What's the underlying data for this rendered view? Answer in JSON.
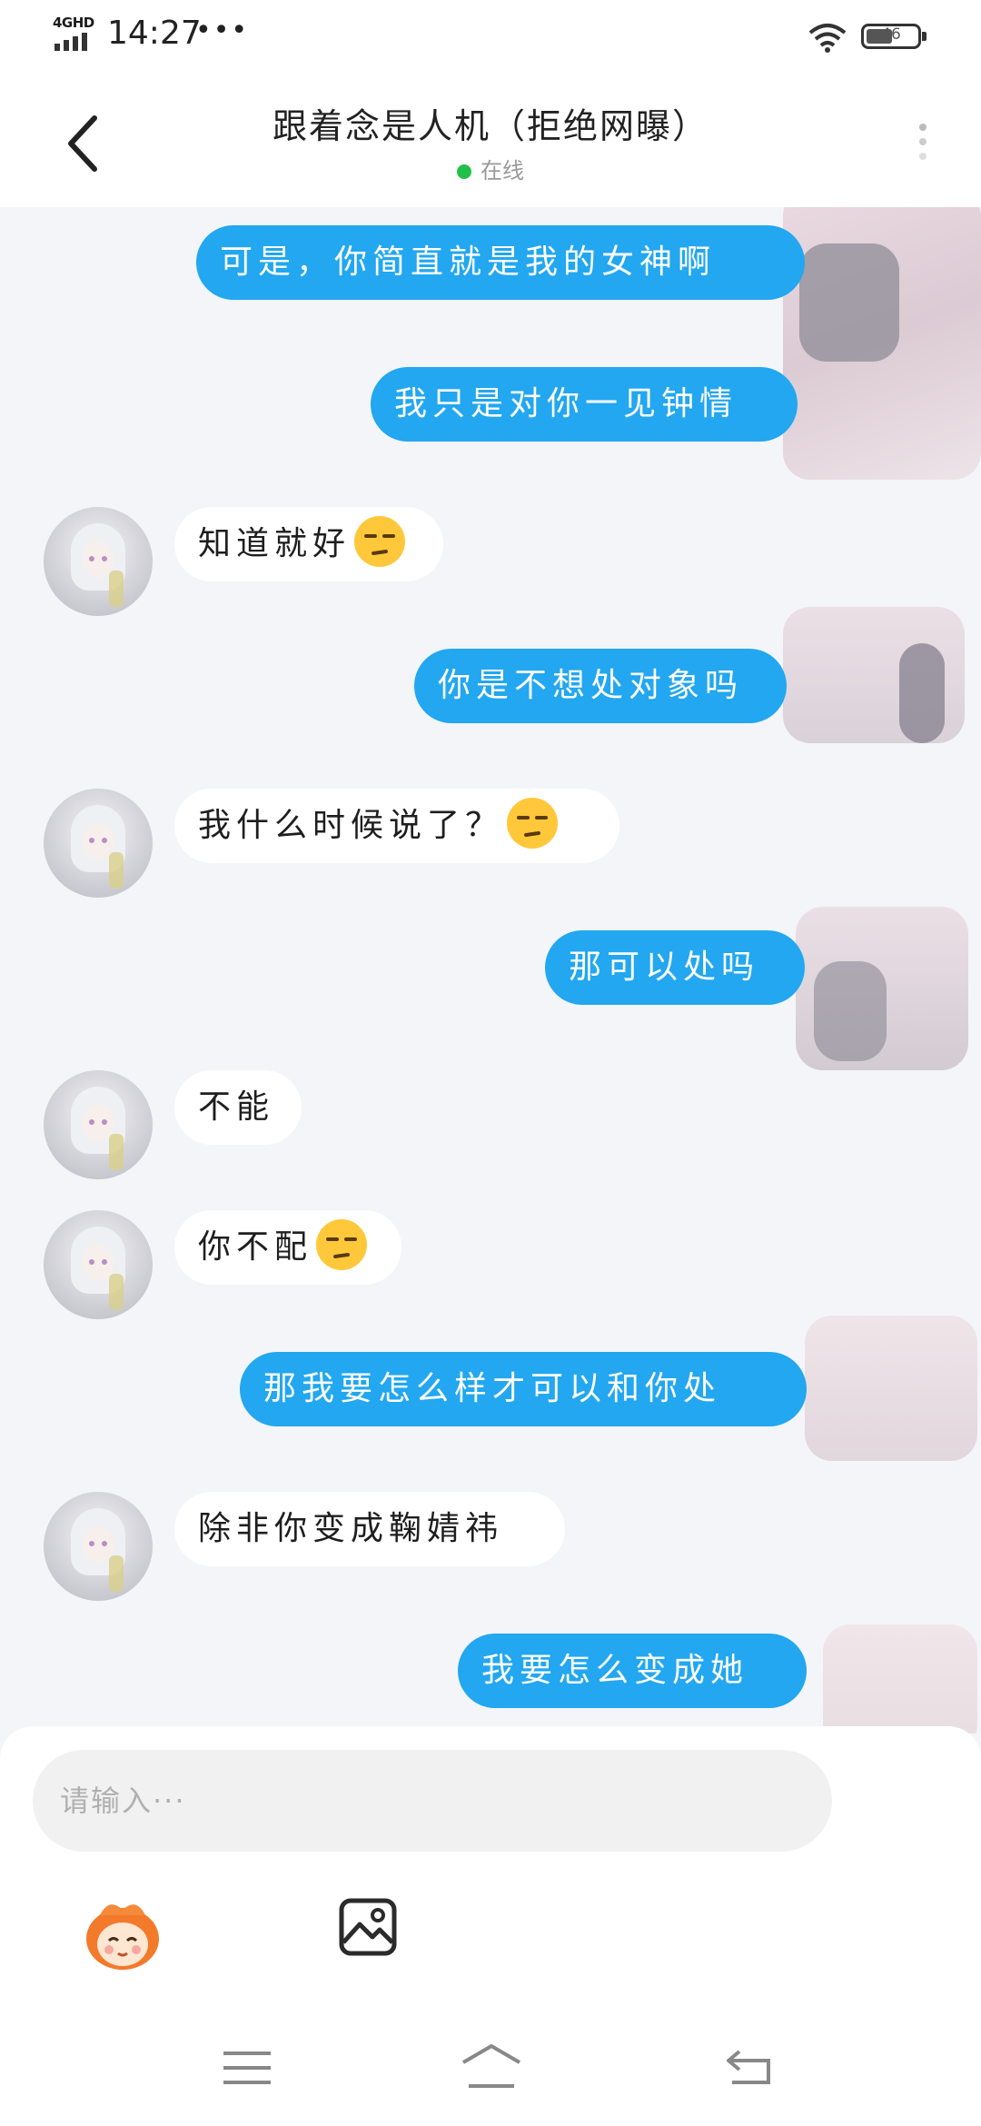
{
  "status_bar": {
    "network": "4GHD",
    "time": "14:27",
    "dots": "•••",
    "battery": "46",
    "icons": [
      "signal-icon",
      "wifi-icon",
      "battery-icon"
    ]
  },
  "header": {
    "title": "跟着念是人机（拒绝网曝）",
    "status": "在线",
    "back_icon": "chevron-left-icon",
    "more_icon": "more-vertical-icon"
  },
  "messages": [
    {
      "side": "out",
      "text": "可是，你简直就是我的女神啊"
    },
    {
      "side": "out",
      "text": "我只是对你一见钟情"
    },
    {
      "side": "in",
      "text": "知道就好",
      "emoji": "unamused-face-icon"
    },
    {
      "side": "out",
      "text": "你是不想处对象吗"
    },
    {
      "side": "in",
      "text": "我什么时候说了？",
      "emoji": "unamused-face-icon"
    },
    {
      "side": "out",
      "text": "那可以处吗"
    },
    {
      "side": "in",
      "text": "不能"
    },
    {
      "side": "in",
      "text": "你不配",
      "emoji": "unamused-face-icon"
    },
    {
      "side": "out",
      "text": "那我要怎么样才可以和你处"
    },
    {
      "side": "in",
      "text": "除非你变成鞠婧祎"
    },
    {
      "side": "out",
      "text": "我要怎么变成她"
    }
  ],
  "composer": {
    "placeholder": "请输入···",
    "tools": [
      "mascot-icon",
      "image-icon"
    ]
  },
  "nav_bar": {
    "icons": [
      "menu-icon",
      "home-icon",
      "back-icon"
    ]
  },
  "colors": {
    "outgoing_bubble": "#22a7f0",
    "incoming_bubble": "#ffffff",
    "background": "#f3f5f8",
    "online_dot": "#22c04a"
  }
}
